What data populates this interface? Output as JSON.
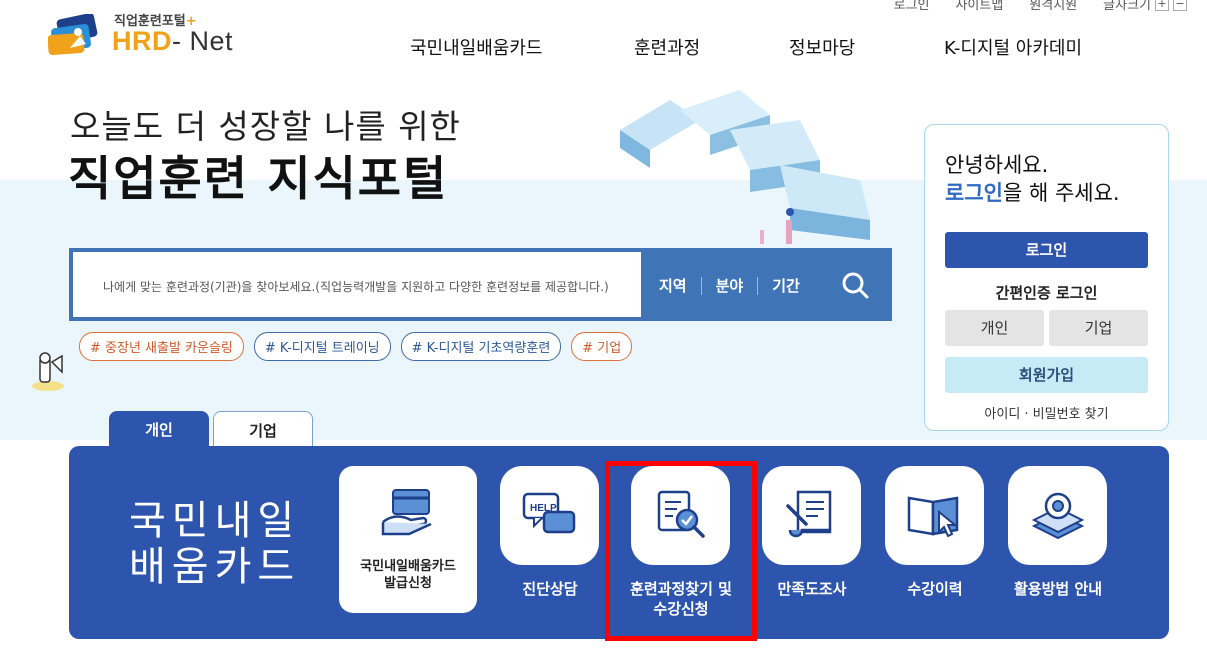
{
  "util_links": [
    "로그인",
    "사이트맵",
    "원격지원",
    "글자크기"
  ],
  "zoom": {
    "plus": "+",
    "minus": "−"
  },
  "logo": {
    "subtitle": "직업훈련포털",
    "plus": "+",
    "main": "HRD",
    "dash": "-",
    "net": " Net"
  },
  "gnb": [
    "국민내일배움카드",
    "훈련과정",
    "정보마당",
    "K-디지털 아카데미"
  ],
  "hero": {
    "line1": "오늘도 더 성장할 나를 위한",
    "line2": "직업훈련 지식포털"
  },
  "search": {
    "placeholder": "나에게 맞는 훈련과정(기관)을 찾아보세요.(직업능력개발을 지원하고 다양한 훈련정보를 제공합니다.)",
    "filters": [
      "지역",
      "분야",
      "기간"
    ]
  },
  "tags": [
    "# 중장년 새출발 카운슬링",
    "# K-디지털 트레이닝",
    "# K-디지털 기초역량훈련",
    "# 기업"
  ],
  "login_box": {
    "greeting": "안녕하세요.",
    "login_word": "로그인",
    "greeting_rest": "을 해 주세요.",
    "login_button": "로그인",
    "easy_login": "간편인증 로그인",
    "personal": "개인",
    "company": "기업",
    "join": "회원가입",
    "find": "아이디 · 비밀번호 찾기"
  },
  "tabs": [
    "개인",
    "기업"
  ],
  "card_panel": {
    "title_line1": "국민내일",
    "title_line2": "배움카드",
    "issue_card": {
      "line1": "국민내일배움카드",
      "line2": "발급신청"
    },
    "services": [
      {
        "label": "진단상담",
        "icon": "help-chat-icon"
      },
      {
        "label_line1": "훈련과정찾기 및",
        "label_line2": "수강신청",
        "icon": "document-search-icon"
      },
      {
        "label": "만족도조사",
        "icon": "scroll-pen-icon"
      },
      {
        "label": "수강이력",
        "icon": "book-cursor-icon"
      },
      {
        "label": "활용방법 안내",
        "icon": "gear-stack-icon"
      }
    ]
  },
  "colors": {
    "primary": "#2d55ad",
    "search_bg": "#3f74b6",
    "accent": "#f0a21b",
    "highlight": "#ff0000"
  }
}
